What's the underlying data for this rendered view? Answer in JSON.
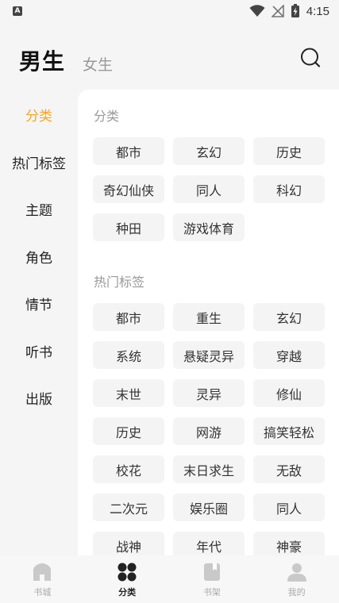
{
  "status_bar": {
    "time": "4:15"
  },
  "header": {
    "tab_male": "男生",
    "tab_female": "女生"
  },
  "sidebar": {
    "items": [
      {
        "label": "分类",
        "active": true
      },
      {
        "label": "热门标签"
      },
      {
        "label": "主题"
      },
      {
        "label": "角色"
      },
      {
        "label": "情节"
      },
      {
        "label": "听书"
      },
      {
        "label": "出版"
      }
    ]
  },
  "sections": [
    {
      "title": "分类",
      "chips": [
        "都市",
        "玄幻",
        "历史",
        "奇幻仙侠",
        "同人",
        "科幻",
        "种田",
        "游戏体育"
      ]
    },
    {
      "title": "热门标签",
      "chips": [
        "都市",
        "重生",
        "玄幻",
        "系统",
        "悬疑灵异",
        "穿越",
        "末世",
        "灵异",
        "修仙",
        "历史",
        "网游",
        "搞笑轻松",
        "校花",
        "末日求生",
        "无敌",
        "二次元",
        "娱乐圈",
        "同人",
        "战神",
        "年代",
        "神豪"
      ]
    }
  ],
  "bottom_nav": {
    "items": [
      {
        "label": "书城",
        "icon": "home-icon"
      },
      {
        "label": "分类",
        "icon": "category-icon",
        "active": true
      },
      {
        "label": "书架",
        "icon": "bookshelf-icon"
      },
      {
        "label": "我的",
        "icon": "profile-icon"
      }
    ]
  },
  "colors": {
    "accent": "#f5a623",
    "inactive_nav": "#c9c9c9",
    "chip_bg": "#f4f4f4"
  }
}
